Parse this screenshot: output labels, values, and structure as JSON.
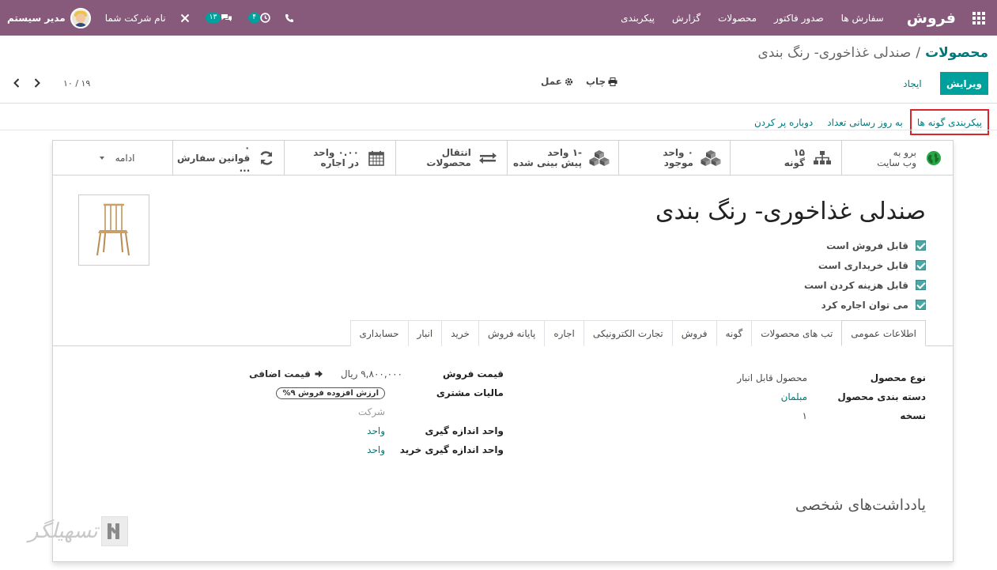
{
  "navbar": {
    "brand": "فروش",
    "menu": [
      "سفارش ها",
      "صدور فاکتور",
      "محصولات",
      "گزارش",
      "پیکربندی"
    ],
    "activity_badge": "۴",
    "messages_badge": "۱۳",
    "company": "نام شرکت شما",
    "user": "مدیر سیستم"
  },
  "breadcrumb": {
    "parent": "محصولات",
    "separator": "/",
    "current": "صندلی غذاخوری- رنگ بندی"
  },
  "buttons": {
    "edit": "ویرایش",
    "create": "ایجاد",
    "print": "چاپ",
    "action": "عمل"
  },
  "pager": {
    "counter": "۱۰ / ۱۹"
  },
  "statusbar": [
    "پیکربندی گونه ها",
    "به روز رسانی تعداد",
    "دوباره پر کردن"
  ],
  "smart_buttons": [
    {
      "line1": "برو به",
      "line2": "وب سایت",
      "icon": "globe-icon"
    },
    {
      "line1": "۱۵",
      "line2": "گونه",
      "icon": "sitemap-icon"
    },
    {
      "line1": "۰ واحد",
      "line2": "موجود",
      "icon": "cubes-icon"
    },
    {
      "line1": "-۱ واحد",
      "line2": "پیش بینی شده",
      "icon": "cubes-icon"
    },
    {
      "line1": "انتقال محصولات",
      "line2": "",
      "icon": "exchange-icon"
    },
    {
      "line1": "۰.۰۰ واحد",
      "line2": "در اجاره",
      "icon": "calendar-icon"
    },
    {
      "line1": "۰",
      "line2": "قوانین سفارش ...",
      "icon": "refresh-icon"
    },
    {
      "line1": "ادامه",
      "line2": "",
      "icon": "caret-down-icon"
    }
  ],
  "product": {
    "name": "صندلی غذاخوری- رنگ بندی",
    "checkboxes": [
      "قابل فروش است",
      "قابل خریداری است",
      "قابل هزینه کردن است",
      "می توان اجاره کرد"
    ]
  },
  "tabs": [
    "اطلاعات عمومی",
    "تب های محصولات",
    "گونه",
    "فروش",
    "تجارت الکترونیکی",
    "اجاره",
    "پایانه فروش",
    "خرید",
    "انبار",
    "حسابداری"
  ],
  "general": {
    "type_label": "نوع محصول",
    "type_value": "محصول قابل انبار",
    "category_label": "دسته بندی محصول",
    "category_value": "مبلمان",
    "version_label": "نسخه",
    "version_value": "۱",
    "price_label": "قیمت فروش",
    "price_value": "۹,۸۰۰,۰۰۰ ریال",
    "extra_price": "قیمت اضافی",
    "tax_label": "مالیات مشتری",
    "tax_value": "ارزش افزوده فروش ۹%",
    "company_placeholder": "شرکت",
    "uom_label": "واحد اندازه گیری",
    "uom_value": "واحد",
    "purchase_uom_label": "واحد اندازه گیری خرید",
    "purchase_uom_value": "واحد"
  },
  "notes_title": "یادداشت‌های شخصی",
  "colors": {
    "brand": "#875a7b",
    "primary": "#00a09d",
    "link": "#00787a",
    "highlight": "#d9262d"
  }
}
